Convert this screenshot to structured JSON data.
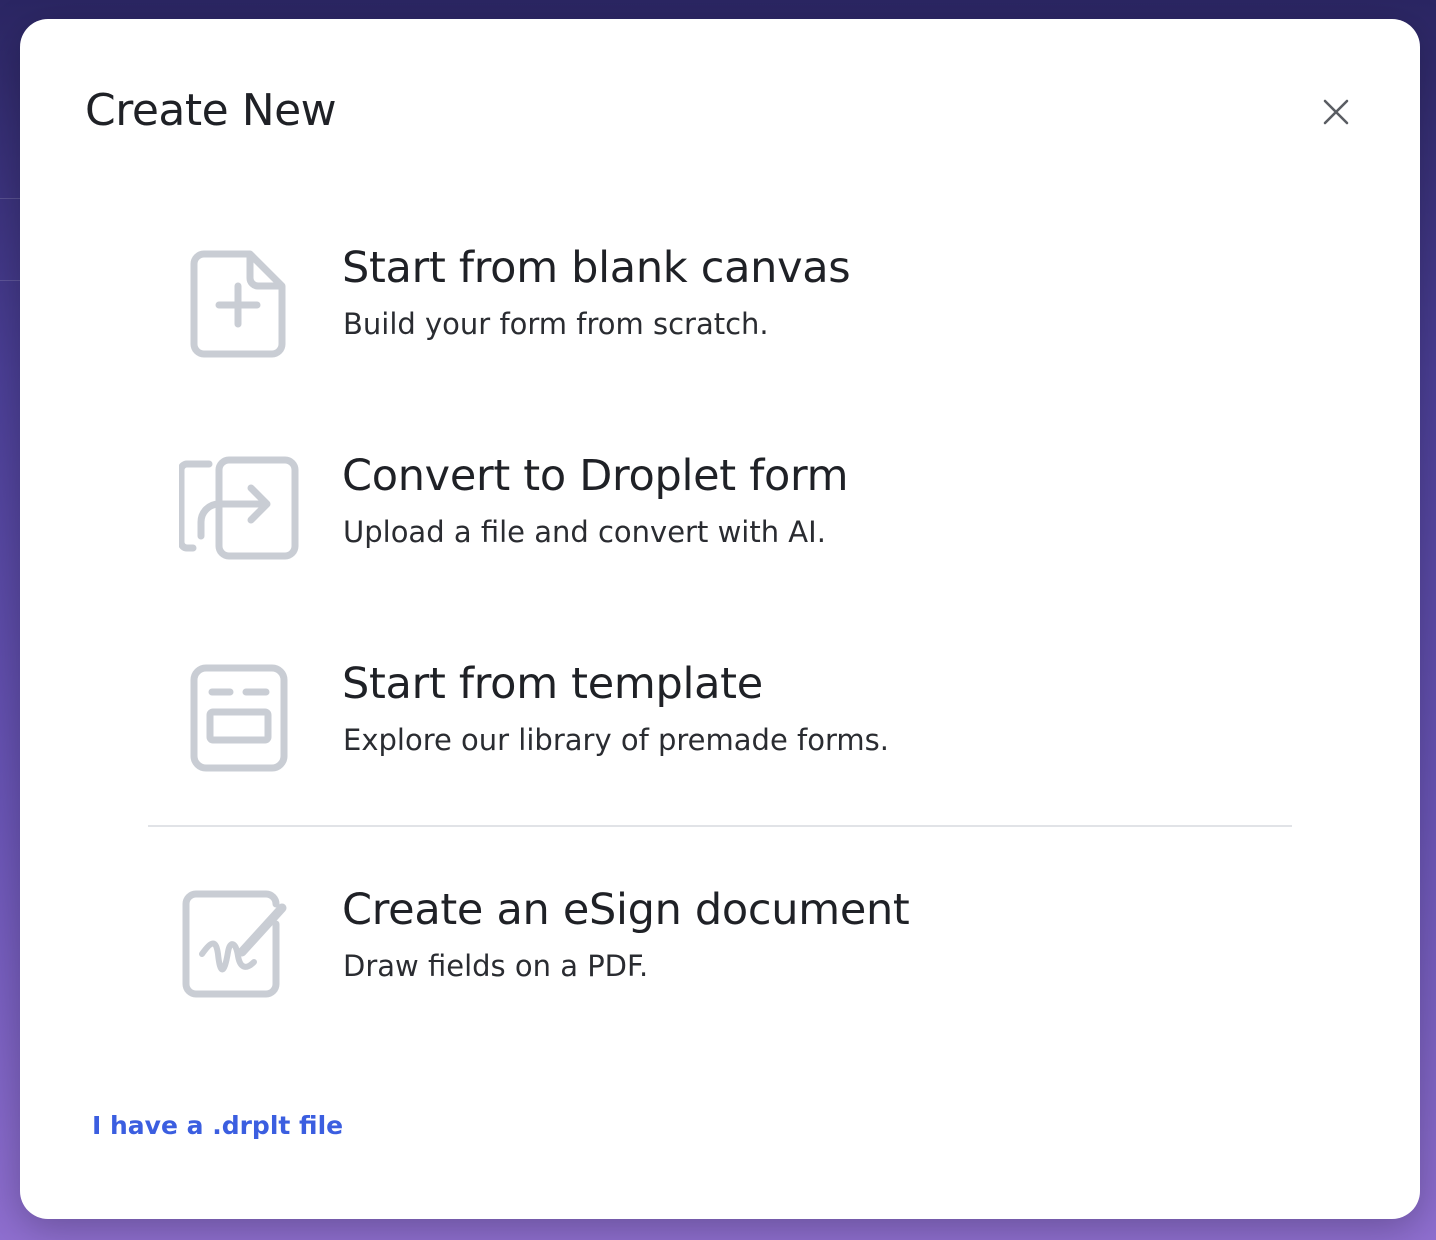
{
  "modal": {
    "title": "Create New",
    "close_icon": "close-icon"
  },
  "options": [
    {
      "title": "Start from blank canvas",
      "description": "Build your form from scratch.",
      "icon": "new-file-icon"
    },
    {
      "title": "Convert to Droplet form",
      "description": "Upload a file and convert with AI.",
      "icon": "convert-icon"
    },
    {
      "title": "Start from template",
      "description": "Explore our library of premade forms.",
      "icon": "template-icon"
    },
    {
      "title": "Create an eSign document",
      "description": "Draw fields on a PDF.",
      "icon": "esign-icon"
    }
  ],
  "footer": {
    "file_link": "I have a .drplt file"
  },
  "colors": {
    "link": "#3b5ee0",
    "icon": "#c9cdd4",
    "text": "#1f2126"
  }
}
